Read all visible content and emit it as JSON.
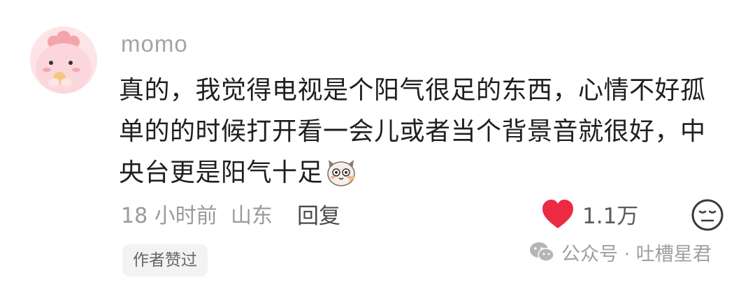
{
  "comment": {
    "username": "momo",
    "text_lines": [
      "真的，我觉得电视是个阳气很足的东西，心情不好孤",
      "单的的时候打开看一会儿或者当个背景音就很好，中",
      "央台更是阳气十足"
    ],
    "sticker": "cat-sticker-icon",
    "time": "18 小时前",
    "location": "山东",
    "reply_label": "回复",
    "like_count": "1.1万",
    "author_badge": "作者赞过"
  },
  "watermark": {
    "text": "公众号 · 吐槽星君",
    "icon": "wechat-icon"
  },
  "colors": {
    "like_red": "#ec2b42",
    "muted_text": "#9a9a9a",
    "avatar_bg": "#fde4e6"
  }
}
